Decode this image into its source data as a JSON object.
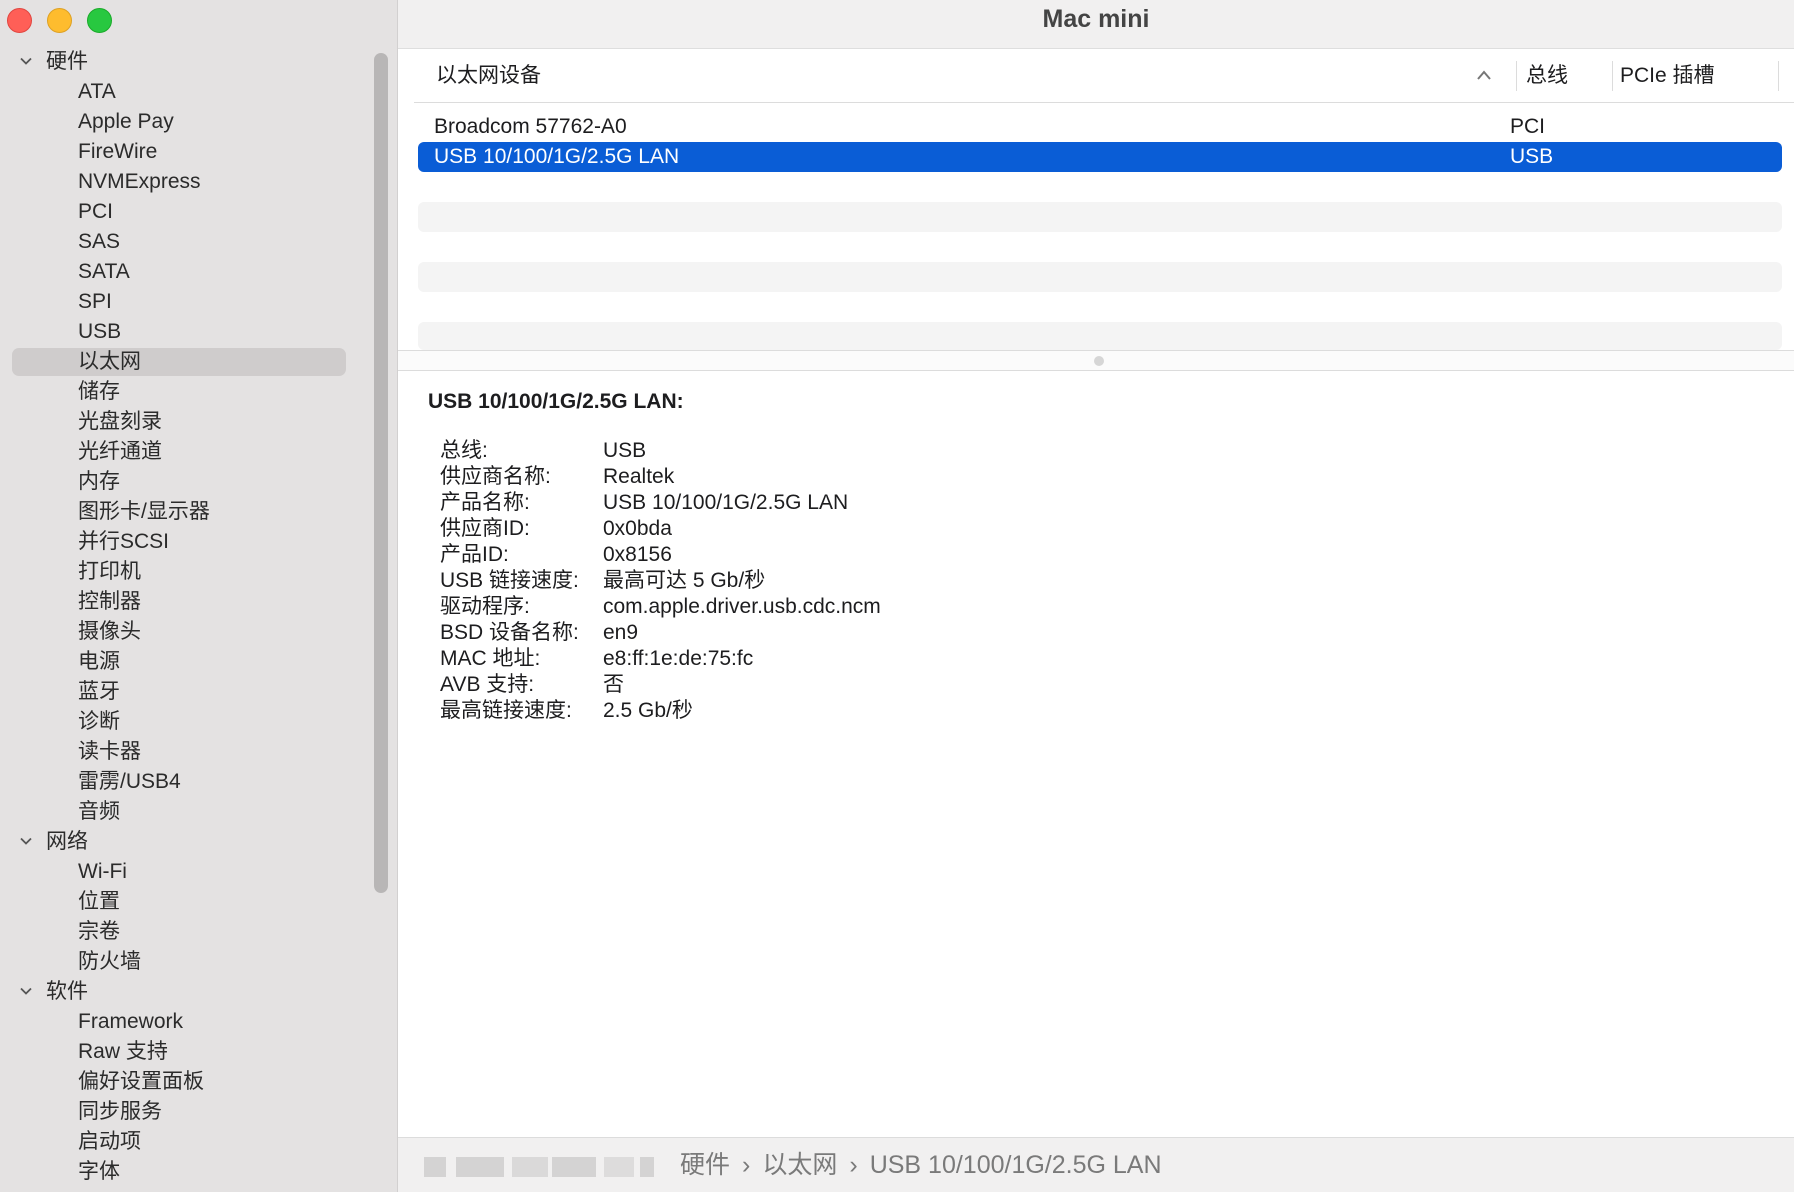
{
  "window": {
    "title": "Mac mini"
  },
  "sidebar": {
    "groups": [
      {
        "label": "硬件",
        "items": [
          "ATA",
          "Apple Pay",
          "FireWire",
          "NVMExpress",
          "PCI",
          "SAS",
          "SATA",
          "SPI",
          "USB",
          "以太网",
          "储存",
          "光盘刻录",
          "光纤通道",
          "内存",
          "图形卡/显示器",
          "并行SCSI",
          "打印机",
          "控制器",
          "摄像头",
          "电源",
          "蓝牙",
          "诊断",
          "读卡器",
          "雷雳/USB4",
          "音频"
        ]
      },
      {
        "label": "网络",
        "items": [
          "Wi-Fi",
          "位置",
          "宗卷",
          "防火墙"
        ]
      },
      {
        "label": "软件",
        "items": [
          "Framework",
          "Raw 支持",
          "偏好设置面板",
          "同步服务",
          "启动项",
          "字体"
        ]
      }
    ],
    "selected": "以太网"
  },
  "table": {
    "columns": {
      "name": "以太网设备",
      "bus": "总线",
      "slot": "PCIe 插槽"
    },
    "rows": [
      {
        "name": "Broadcom 57762-A0",
        "bus": "PCI"
      },
      {
        "name": "USB 10/100/1G/2.5G LAN",
        "bus": "USB",
        "selected": true
      }
    ]
  },
  "detail": {
    "title": "USB 10/100/1G/2.5G LAN:",
    "fields": [
      {
        "k": "总线:",
        "v": "USB"
      },
      {
        "k": "供应商名称:",
        "v": "Realtek"
      },
      {
        "k": "产品名称:",
        "v": "USB 10/100/1G/2.5G LAN"
      },
      {
        "k": "供应商ID:",
        "v": "0x0bda"
      },
      {
        "k": "产品ID:",
        "v": "0x8156"
      },
      {
        "k": "USB 链接速度:",
        "v": "最高可达 5 Gb/秒"
      },
      {
        "k": "驱动程序:",
        "v": "com.apple.driver.usb.cdc.ncm"
      },
      {
        "k": "BSD 设备名称:",
        "v": "en9"
      },
      {
        "k": "MAC 地址:",
        "v": "e8:ff:1e:de:75:fc"
      },
      {
        "k": "AVB 支持:",
        "v": "否"
      },
      {
        "k": "最高链接速度:",
        "v": "2.5 Gb/秒"
      }
    ]
  },
  "pathbar": {
    "crumbs": [
      "硬件",
      "以太网",
      "USB 10/100/1G/2.5G LAN"
    ],
    "separator": "›"
  },
  "colors": {
    "selection": "#0a5dd6",
    "sidebar_bg": "#e4e2e2",
    "sidebar_selected": "#cfcccc"
  }
}
